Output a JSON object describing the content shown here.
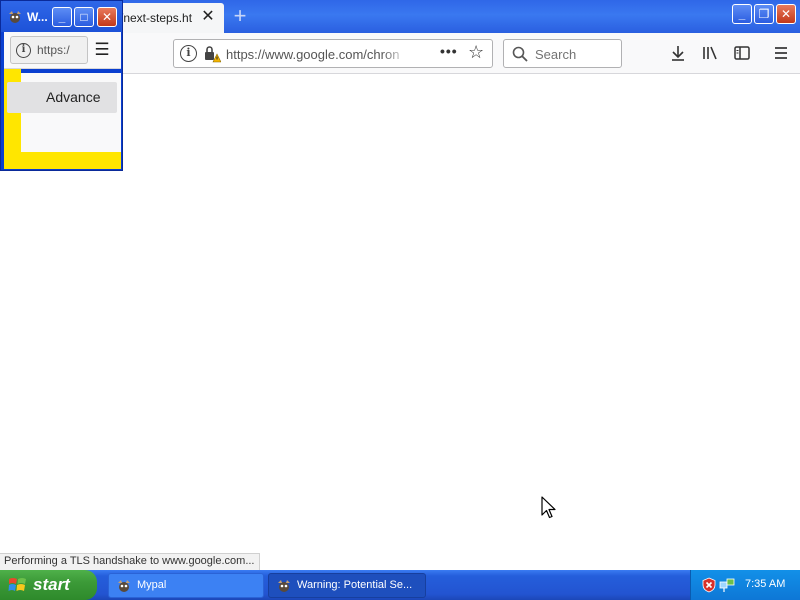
{
  "browser": {
    "active_tab": {
      "title": "/next-steps.ht",
      "close_glyph": "✕"
    },
    "new_tab_glyph": "+",
    "window_controls": {
      "minimize": "_",
      "restore": "❐",
      "close": "✕"
    },
    "url": "https://www.google.com/chron",
    "page_actions_glyph": "•••",
    "bookmark_glyph": "☆",
    "search_placeholder": "Search",
    "toolbar_icons": [
      "downloads-icon",
      "library-icon",
      "sidebar-icon",
      "menu-icon"
    ],
    "status_text": "Performing a TLS handshake to www.google.com..."
  },
  "popup": {
    "title": "W...",
    "window_controls": {
      "minimize": "_",
      "maximize": "□",
      "close": "✕"
    },
    "url_partial": "https:/",
    "menu_glyph": "☰",
    "advanced_button": "Advance"
  },
  "taskbar": {
    "start_label": "start",
    "tasks": [
      {
        "label": "Mypal",
        "active": false
      },
      {
        "label": "Warning: Potential Se...",
        "active": true
      }
    ],
    "clock": "7:35 AM"
  },
  "colors": {
    "titlebar_blue": "#2f67e8",
    "popup_yellow": "#ffe600",
    "start_green": "#3c9a38",
    "tray_blue": "#1290e8"
  }
}
